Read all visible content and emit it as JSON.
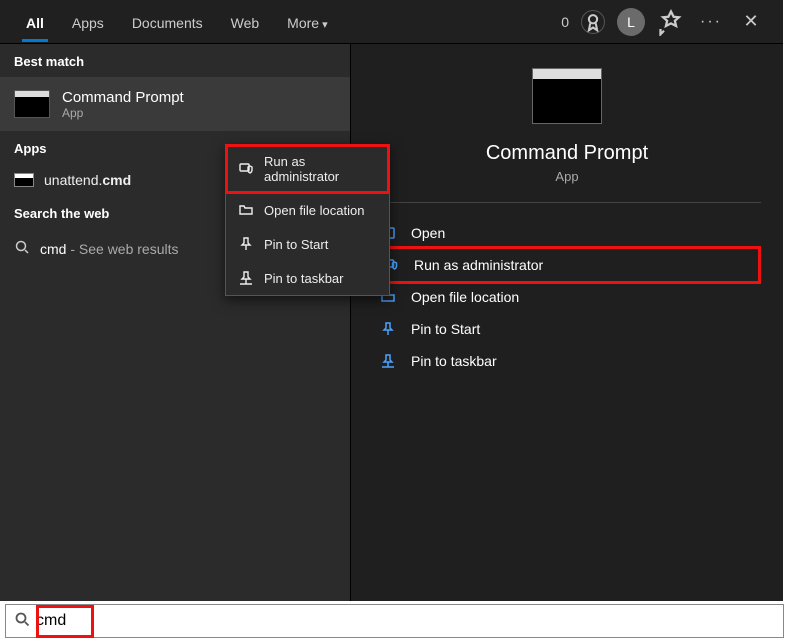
{
  "tabs": {
    "all": "All",
    "apps": "Apps",
    "documents": "Documents",
    "web": "Web",
    "more": "More"
  },
  "header": {
    "points": "0",
    "avatar_letter": "L"
  },
  "left": {
    "label_best": "Best match",
    "best": {
      "title": "Command Prompt",
      "sub": "App"
    },
    "label_apps": "Apps",
    "app_result": {
      "prefix": "unattend.",
      "bold": "cmd"
    },
    "label_web": "Search the web",
    "web": {
      "term": "cmd",
      "suffix": " - See web results"
    }
  },
  "flyout": {
    "run_admin": "Run as administrator",
    "open_loc": "Open file location",
    "pin_start": "Pin to Start",
    "pin_taskbar": "Pin to taskbar"
  },
  "right": {
    "title": "Command Prompt",
    "sub": "App",
    "actions": {
      "open": "Open",
      "run_admin": "Run as administrator",
      "open_loc": "Open file location",
      "pin_start": "Pin to Start",
      "pin_taskbar": "Pin to taskbar"
    }
  },
  "search": {
    "value": "cmd"
  }
}
